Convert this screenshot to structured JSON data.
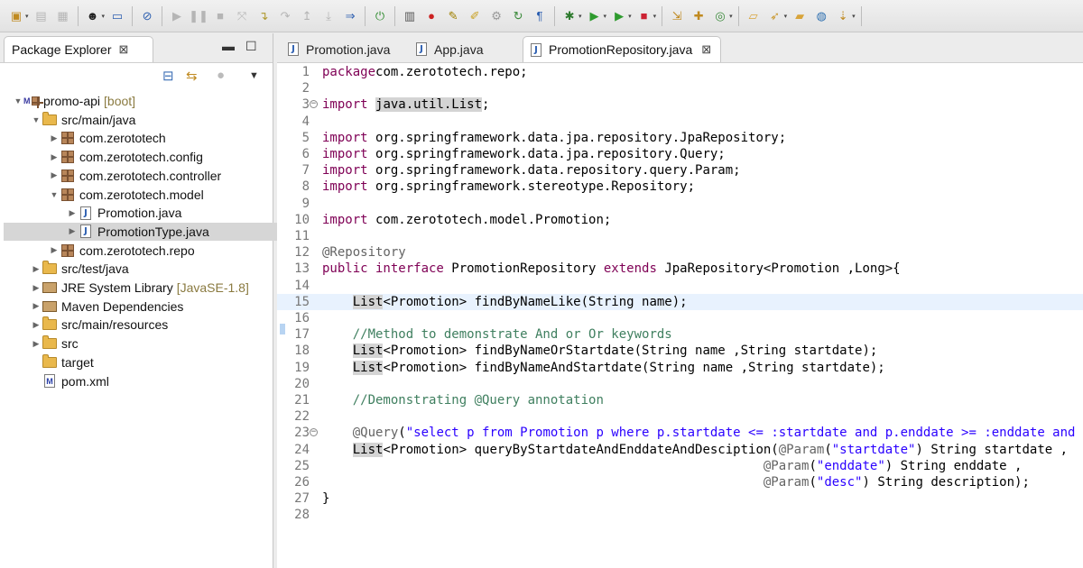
{
  "toolbar": {
    "icons": [
      "new-icon",
      "save-icon",
      "save-all-icon",
      "user-icon",
      "monitor-icon",
      "skip-breakpoints-icon",
      "resume-icon",
      "suspend-icon",
      "terminate-icon",
      "disconnect-icon",
      "step-into-icon",
      "step-over-icon",
      "step-return-icon",
      "drop-frame-icon",
      "use-step-filters-icon",
      "spring-icon",
      "toggle-mark-icon",
      "error-icon",
      "highlight-icon",
      "brush-icon",
      "gears-icon",
      "refresh-icon",
      "pilcrow-icon",
      "debug-icon",
      "run-icon",
      "run-tools-icon",
      "stop-icon",
      "deploy-icon",
      "new-package-icon",
      "new-class-icon",
      "open-folder-icon",
      "rocket-icon",
      "open-type-icon",
      "globe-icon",
      "next-annotation-icon"
    ]
  },
  "explorer": {
    "tab_label": "Package Explorer",
    "tree": [
      {
        "id": "promo-api",
        "label": "promo-api",
        "decor": "[boot]",
        "level": 0,
        "expanded": true,
        "icon": "project-icon"
      },
      {
        "id": "src-main-java",
        "label": "src/main/java",
        "level": 1,
        "expanded": true,
        "icon": "source-folder-icon"
      },
      {
        "id": "com-zerototech",
        "label": "com.zerototech",
        "level": 2,
        "expanded": false,
        "icon": "package-icon"
      },
      {
        "id": "com-zerototech-config",
        "label": "com.zerototech.config",
        "level": 2,
        "expanded": false,
        "icon": "package-icon"
      },
      {
        "id": "com-zerototech-controller",
        "label": "com.zerototech.controller",
        "level": 2,
        "expanded": false,
        "icon": "package-icon"
      },
      {
        "id": "com-zerototech-model",
        "label": "com.zerototech.model",
        "level": 2,
        "expanded": true,
        "icon": "package-icon"
      },
      {
        "id": "promotion-java",
        "label": "Promotion.java",
        "level": 3,
        "expanded": false,
        "icon": "java-file-icon"
      },
      {
        "id": "promotiontype-java",
        "label": "PromotionType.java",
        "level": 3,
        "expanded": false,
        "icon": "java-file-icon",
        "selected": true
      },
      {
        "id": "com-zerototech-repo",
        "label": "com.zerototech.repo",
        "level": 2,
        "expanded": false,
        "icon": "package-icon"
      },
      {
        "id": "src-test-java",
        "label": "src/test/java",
        "level": 1,
        "expanded": false,
        "icon": "source-folder-icon"
      },
      {
        "id": "jre-system-library",
        "label": "JRE System Library",
        "decor": "[JavaSE-1.8]",
        "level": 1,
        "expanded": false,
        "icon": "library-icon"
      },
      {
        "id": "maven-dependencies",
        "label": "Maven Dependencies",
        "level": 1,
        "expanded": false,
        "icon": "library-icon"
      },
      {
        "id": "src-main-resources",
        "label": "src/main/resources",
        "level": 1,
        "expanded": false,
        "icon": "source-folder-icon"
      },
      {
        "id": "src",
        "label": "src",
        "level": 1,
        "expanded": false,
        "icon": "folder-icon"
      },
      {
        "id": "target",
        "label": "target",
        "level": 1,
        "leaf": true,
        "icon": "folder-icon"
      },
      {
        "id": "pom-xml",
        "label": "pom.xml",
        "level": 1,
        "leaf": true,
        "icon": "maven-file-icon"
      }
    ]
  },
  "editor": {
    "tabs": [
      {
        "label": "Promotion.java",
        "active": false
      },
      {
        "label": "App.java",
        "active": false
      },
      {
        "label": "PromotionRepository.java",
        "active": true
      }
    ],
    "current_line": 15,
    "lines": [
      {
        "n": "1",
        "t": [
          [
            "kw",
            "package"
          ],
          [
            "",
            "com.zerototech.repo;"
          ]
        ]
      },
      {
        "n": "2",
        "t": []
      },
      {
        "n": "3",
        "fold": true,
        "t": [
          [
            "kw",
            "import"
          ],
          [
            "",
            " "
          ],
          [
            "occ",
            "java.util.List"
          ],
          [
            "",
            ";"
          ]
        ]
      },
      {
        "n": "4",
        "t": []
      },
      {
        "n": "5",
        "t": [
          [
            "kw",
            "import"
          ],
          [
            "",
            " org.springframework.data.jpa.repository.JpaRepository;"
          ]
        ]
      },
      {
        "n": "6",
        "t": [
          [
            "kw",
            "import"
          ],
          [
            "",
            " org.springframework.data.jpa.repository.Query;"
          ]
        ]
      },
      {
        "n": "7",
        "t": [
          [
            "kw",
            "import"
          ],
          [
            "",
            " org.springframework.data.repository.query.Param;"
          ]
        ]
      },
      {
        "n": "8",
        "t": [
          [
            "kw",
            "import"
          ],
          [
            "",
            " org.springframework.stereotype.Repository;"
          ]
        ]
      },
      {
        "n": "9",
        "t": []
      },
      {
        "n": "10",
        "t": [
          [
            "kw",
            "import"
          ],
          [
            "",
            " com.zerototech.model.Promotion;"
          ]
        ]
      },
      {
        "n": "11",
        "t": []
      },
      {
        "n": "12",
        "t": [
          [
            "an",
            "@Repository"
          ]
        ]
      },
      {
        "n": "13",
        "t": [
          [
            "kw",
            "public interface"
          ],
          [
            "",
            " PromotionRepository "
          ],
          [
            "kw",
            "extends"
          ],
          [
            "",
            " JpaRepository<Promotion ,Long>{"
          ]
        ]
      },
      {
        "n": "14",
        "t": []
      },
      {
        "n": "15",
        "t": [
          [
            "",
            "    "
          ],
          [
            "cursor",
            ""
          ],
          [
            "occ",
            "List"
          ],
          [
            "",
            "<Promotion> findByNameLike(String name);"
          ]
        ]
      },
      {
        "n": "16",
        "t": []
      },
      {
        "n": "17",
        "t": [
          [
            "",
            "    "
          ],
          [
            "cm",
            "//Method to demonstrate And or Or keywords"
          ]
        ]
      },
      {
        "n": "18",
        "t": [
          [
            "",
            "    "
          ],
          [
            "occ",
            "List"
          ],
          [
            "",
            "<Promotion> findByNameOrStartdate(String name ,String startdate);"
          ]
        ]
      },
      {
        "n": "19",
        "t": [
          [
            "",
            "    "
          ],
          [
            "occ",
            "List"
          ],
          [
            "",
            "<Promotion> findByNameAndStartdate(String name ,String startdate);"
          ]
        ]
      },
      {
        "n": "20",
        "t": []
      },
      {
        "n": "21",
        "t": [
          [
            "",
            "    "
          ],
          [
            "cm",
            "//Demonstrating @Query annotation"
          ]
        ]
      },
      {
        "n": "22",
        "t": []
      },
      {
        "n": "23",
        "fold": true,
        "t": [
          [
            "",
            "    "
          ],
          [
            "an",
            "@Query"
          ],
          [
            "",
            "("
          ],
          [
            "st",
            "\"select p from Promotion p where p.startdate <= :startdate and p.enddate >= :enddate and descr"
          ]
        ]
      },
      {
        "n": "24",
        "t": [
          [
            "",
            "    "
          ],
          [
            "occ",
            "List"
          ],
          [
            "",
            "<Promotion> queryByStartdateAndEnddateAndDesciption("
          ],
          [
            "an",
            "@Param"
          ],
          [
            "",
            "("
          ],
          [
            "st",
            "\"startdate\""
          ],
          [
            "",
            ") String startdate ,"
          ]
        ]
      },
      {
        "n": "25",
        "t": [
          [
            "",
            "                                                          "
          ],
          [
            "an",
            "@Param"
          ],
          [
            "",
            "("
          ],
          [
            "st",
            "\"enddate\""
          ],
          [
            "",
            ") String enddate ,"
          ]
        ]
      },
      {
        "n": "26",
        "t": [
          [
            "",
            "                                                          "
          ],
          [
            "an",
            "@Param"
          ],
          [
            "",
            "("
          ],
          [
            "st",
            "\"desc\""
          ],
          [
            "",
            ") String description);"
          ]
        ]
      },
      {
        "n": "27",
        "t": [
          [
            "",
            "}"
          ]
        ]
      },
      {
        "n": "28",
        "t": []
      }
    ]
  }
}
